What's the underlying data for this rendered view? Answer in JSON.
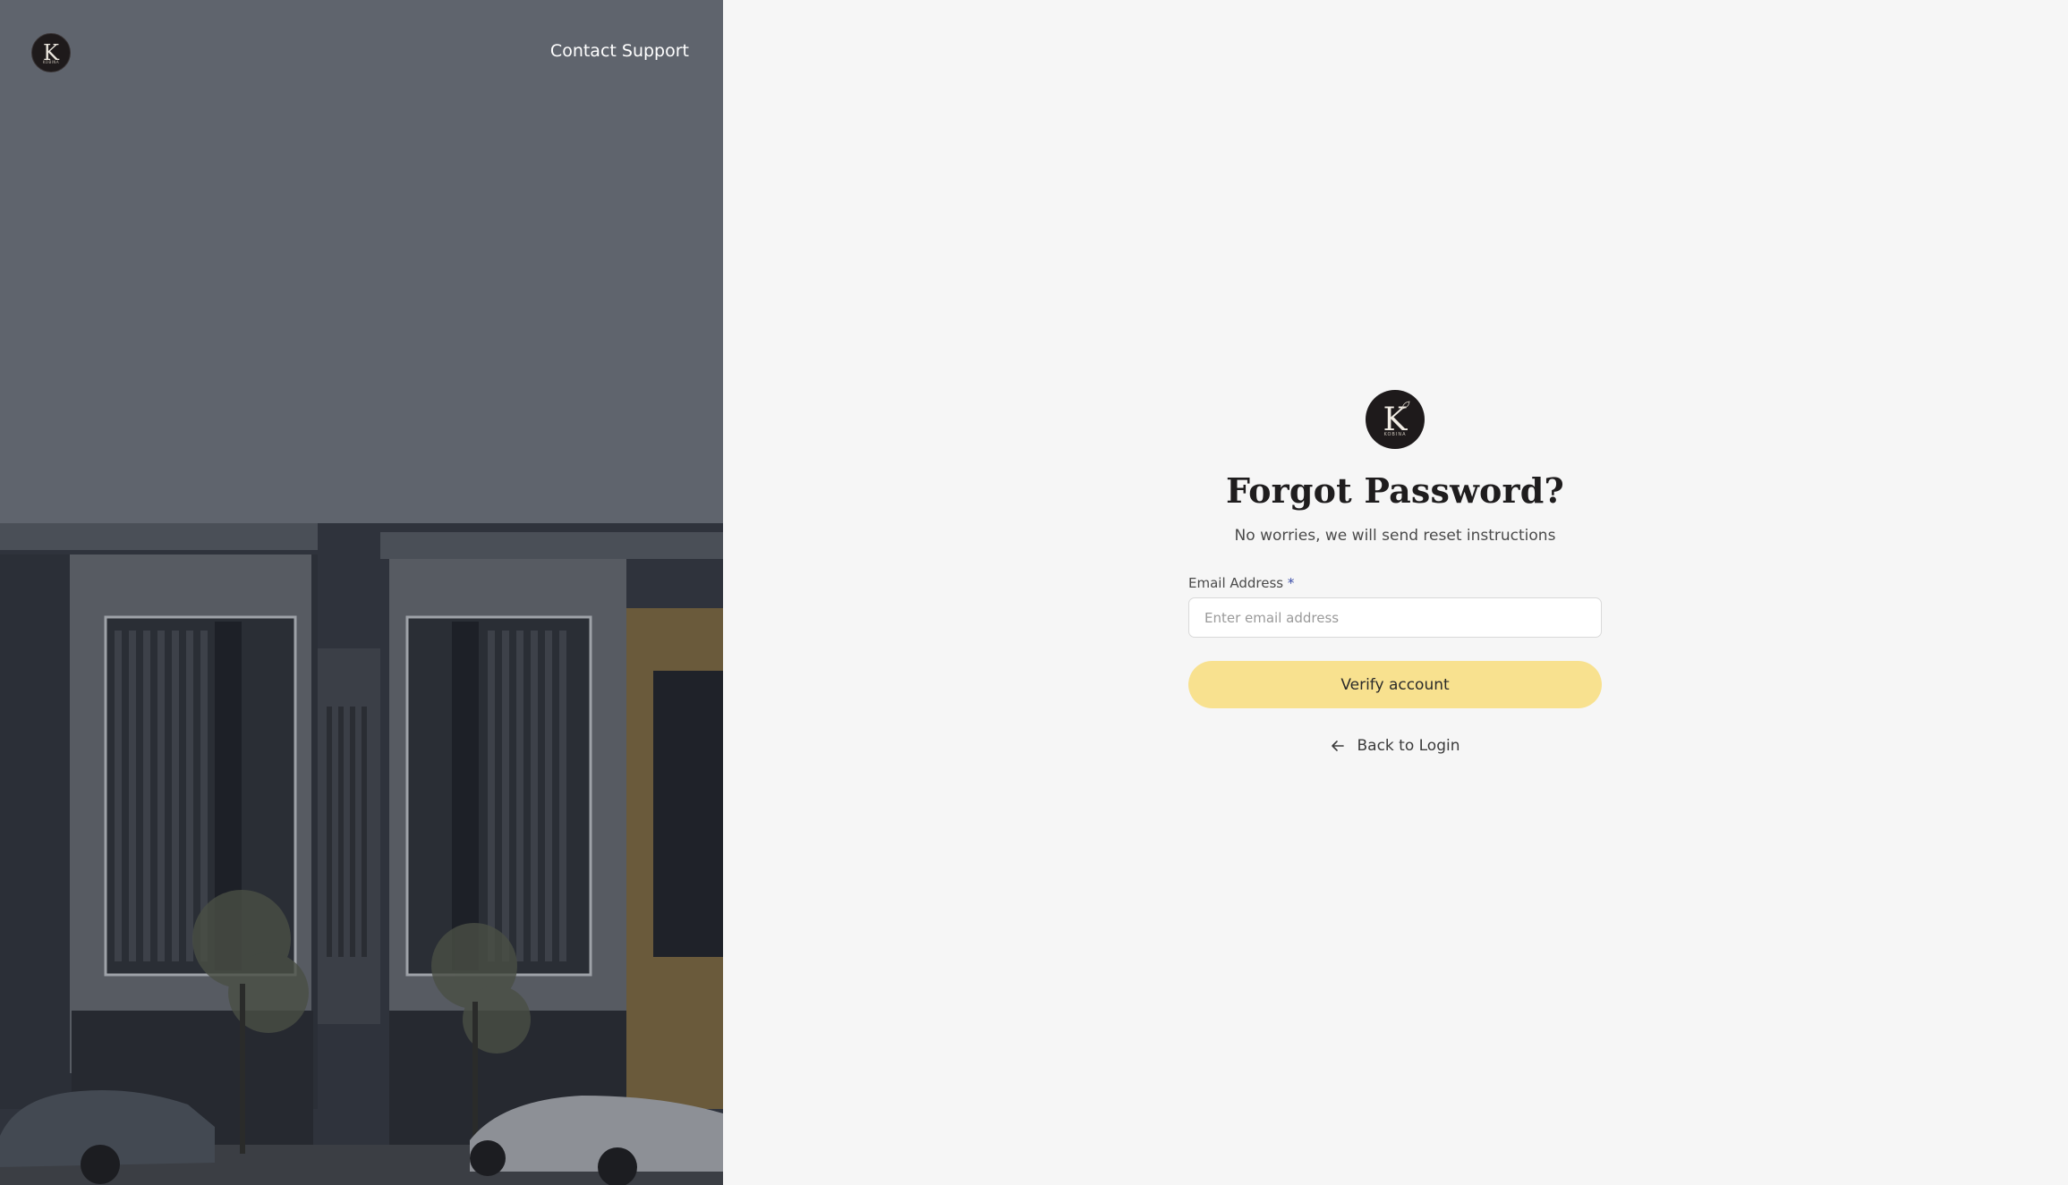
{
  "hero": {
    "logo_letter": "K",
    "logo_subtext": "KOBINA",
    "contact_label": "Contact Support"
  },
  "form": {
    "logo_letter": "K",
    "logo_subtext": "KOBINA",
    "title": "Forgot Password?",
    "subtitle": "No worries, we will send reset instructions",
    "email_label": "Email Address",
    "required_mark": "*",
    "email_placeholder": "Enter email address",
    "email_value": "",
    "submit_label": "Verify account",
    "back_label": "Back to Login"
  },
  "colors": {
    "accent_button": "#f8e18f",
    "hero_overlay": "#5f646d",
    "logo_bg": "#1e1a1b",
    "required": "#3c4ea8"
  },
  "icons": {
    "back": "arrow-left-icon"
  }
}
